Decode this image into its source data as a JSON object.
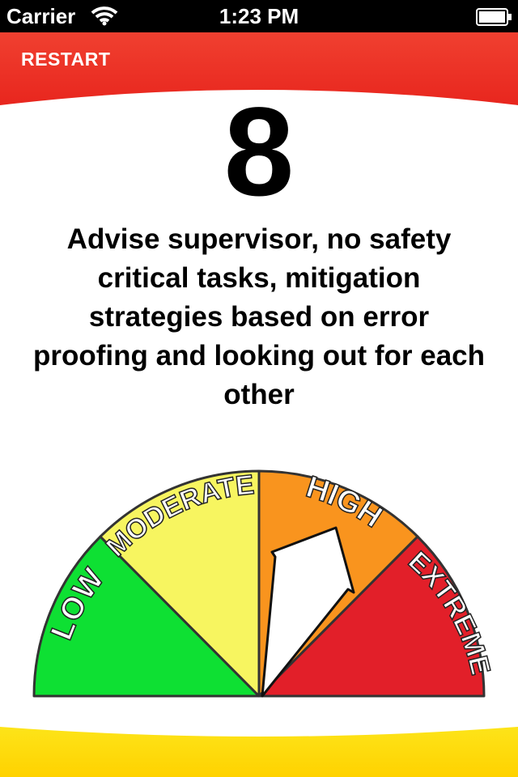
{
  "status_bar": {
    "carrier": "Carrier",
    "time": "1:23 PM",
    "wifi_icon": "wifi-icon",
    "battery_icon": "battery-icon"
  },
  "header": {
    "restart_label": "RESTART",
    "accent_color": "#ee3a2c"
  },
  "result": {
    "score": "8",
    "advice": "Advise supervisor, no safety critical tasks,  mitigation strategies based on error proofing and looking out for each other"
  },
  "gauge": {
    "segments": [
      {
        "label": "LOW",
        "color": "#0ee033"
      },
      {
        "label": "MODERATE",
        "color": "#f7f560"
      },
      {
        "label": "HIGH",
        "color": "#f9941e"
      },
      {
        "label": "EXTREME",
        "color": "#e21f29"
      }
    ],
    "indicator": "HIGH",
    "needle_icon": "arrow-needle-icon"
  },
  "footer": {
    "accent_color": "#ffd500"
  }
}
